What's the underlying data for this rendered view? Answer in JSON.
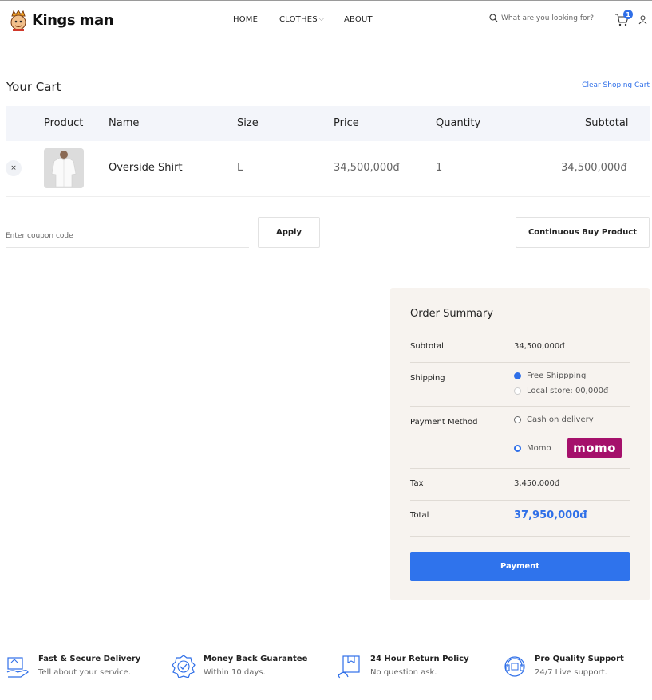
{
  "brand": {
    "name": "Kings man"
  },
  "nav": {
    "home": "HOME",
    "clothes": "CLOTHES",
    "about": "ABOUT"
  },
  "search": {
    "placeholder": "What are you looking for?"
  },
  "cart_badge": "1",
  "cart": {
    "title": "Your Cart",
    "clear_label": "Clear Shoping Cart",
    "headers": {
      "product": "Product",
      "name": "Name",
      "size": "Size",
      "price": "Price",
      "quantity": "Quantity",
      "subtotal": "Subtotal"
    },
    "items": [
      {
        "remove": "×",
        "name": "Overside Shirt",
        "size": "L",
        "price": "34,500,000đ",
        "quantity": "1",
        "subtotal": "34,500,000đ"
      }
    ],
    "coupon_placeholder": "Enter coupon code",
    "apply_label": "Apply",
    "continue_label": "Continuous Buy Product"
  },
  "summary": {
    "title": "Order Summary",
    "subtotal_label": "Subtotal",
    "subtotal_value": "34,500,000đ",
    "shipping_label": "Shipping",
    "shipping_options": [
      "Free Shippping",
      "Local store: 00,000đ"
    ],
    "shipping_selected": 0,
    "payment_label": "Payment Method",
    "payment_options": [
      "Cash on delivery",
      "Momo"
    ],
    "payment_selected": 1,
    "momo_logo": "momo",
    "tax_label": "Tax",
    "tax_value": "3,450,000đ",
    "total_label": "Total",
    "total_value": "37,950,000đ",
    "payment_button": "Payment"
  },
  "features": [
    {
      "icon": "delivery-icon",
      "title": "Fast & Secure Delivery",
      "subtitle": "Tell about your service."
    },
    {
      "icon": "badge-check-icon",
      "title": "Money Back Guarantee",
      "subtitle": "Within 10 days."
    },
    {
      "icon": "return-box-icon",
      "title": "24 Hour Return Policy",
      "subtitle": "No question ask."
    },
    {
      "icon": "support-icon",
      "title": "Pro Quality Support",
      "subtitle": "24/7 Live support."
    }
  ],
  "colors": {
    "accent": "#2f6fe8",
    "summary_bg": "#f7f3ef",
    "header_bg": "#f3f5fa",
    "momo": "#a5106b"
  }
}
